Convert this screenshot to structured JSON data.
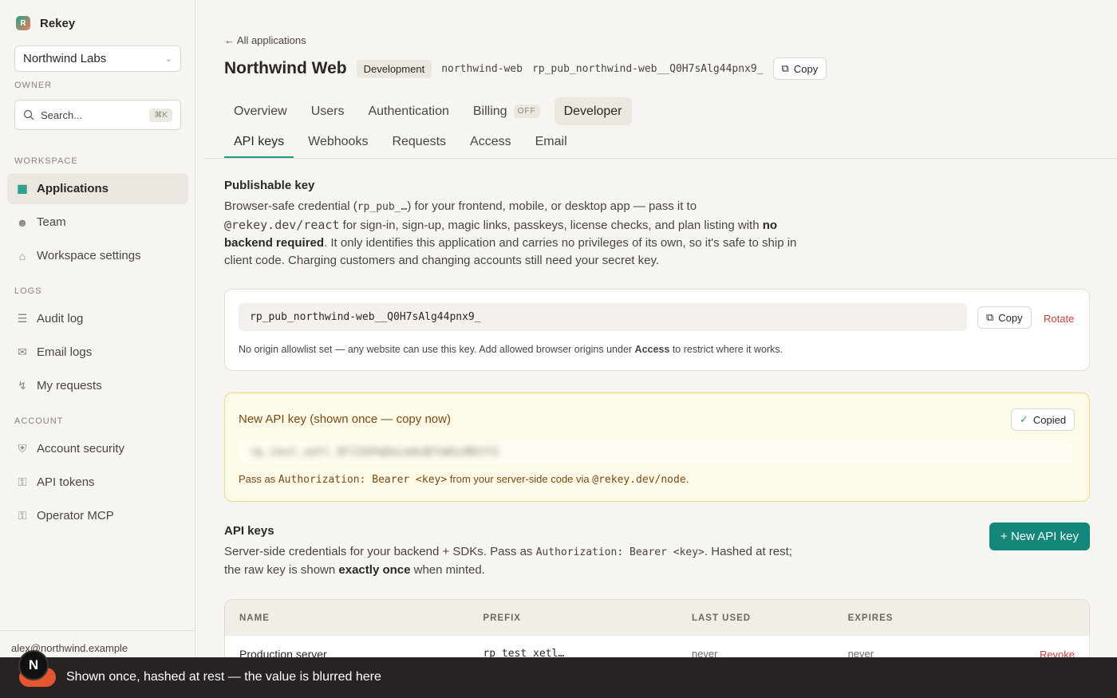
{
  "brand": {
    "name": "Rekey",
    "logo_letter": "R"
  },
  "org_select": {
    "value": "Northwind Labs"
  },
  "owner_label": "OWNER",
  "search": {
    "placeholder": "Search...",
    "shortcut": "⌘K"
  },
  "sections": {
    "workspace": "WORKSPACE",
    "logs": "LOGS",
    "account": "ACCOUNT"
  },
  "nav": {
    "applications": "Applications",
    "team": "Team",
    "workspace_settings": "Workspace settings",
    "audit_log": "Audit log",
    "email_logs": "Email logs",
    "my_requests": "My requests",
    "account_security": "Account security",
    "api_tokens": "API tokens",
    "operator_mcp": "Operator MCP"
  },
  "user_email": "alex@northwind.example",
  "header": {
    "back": "← All applications",
    "title": "Northwind Web",
    "env_badge": "Development",
    "slug": "northwind-web",
    "pub_key": "rp_pub_northwind-web__Q0H7sAlg44pnx9_",
    "copy": "Copy"
  },
  "tabs_primary": {
    "overview": "Overview",
    "users": "Users",
    "authentication": "Authentication",
    "billing": "Billing",
    "billing_badge": "OFF",
    "developer": "Developer"
  },
  "tabs_secondary": {
    "api_keys": "API keys",
    "webhooks": "Webhooks",
    "requests": "Requests",
    "access": "Access",
    "email": "Email"
  },
  "publishable": {
    "heading": "Publishable key",
    "p1": "Browser-safe credential (",
    "p1_code": "rp_pub_…",
    "p2": ") for your frontend, mobile, or desktop app — pass it to",
    "p3_code": "@rekey.dev/react",
    "p4": " for sign-in, sign-up, magic links, passkeys, license checks, and plan listing with ",
    "p5_bold": "no backend required",
    "p6": ". It only identifies this application and carries no privileges of its own, so it's safe to ship in client code. Charging customers and changing accounts still need your secret key.",
    "key_value": "rp_pub_northwind-web__Q0H7sAlg44pnx9_",
    "copy": "Copy",
    "rotate": "Rotate",
    "note_a": "No origin allowlist set — any website can use this key. Add allowed browser origins under ",
    "note_bold": "Access",
    "note_b": " to restrict where it works."
  },
  "new_key": {
    "title": "New API key (shown once — copy now)",
    "copied": "Copied",
    "blurred_value": "rp_test_xetl_8fJ2kPq9sLm4vB7nW1zR6tY3",
    "note_a": "Pass as ",
    "note_code1": "Authorization: Bearer <key>",
    "note_b": " from your server-side code via ",
    "note_code2": "@rekey.dev/node",
    "note_c": "."
  },
  "api_keys": {
    "heading": "API keys",
    "p1": "Server-side credentials for your backend + SDKs. Pass as ",
    "p1_code": "Authorization: Bearer <key>",
    "p2": ". Hashed at rest; the raw key is shown ",
    "p2_bold": "exactly once",
    "p3": " when minted.",
    "new_button": "+ New API key",
    "columns": [
      "NAME",
      "PREFIX",
      "LAST USED",
      "EXPIRES"
    ],
    "rows": [
      {
        "name": "Production server",
        "prefix": "rp_test_xetl…",
        "last_used": "never",
        "expires": "never",
        "action": "Revoke"
      }
    ]
  },
  "toast": {
    "avatar_letter": "N",
    "text": "Shown once, hashed at rest — the value is blurred here"
  }
}
